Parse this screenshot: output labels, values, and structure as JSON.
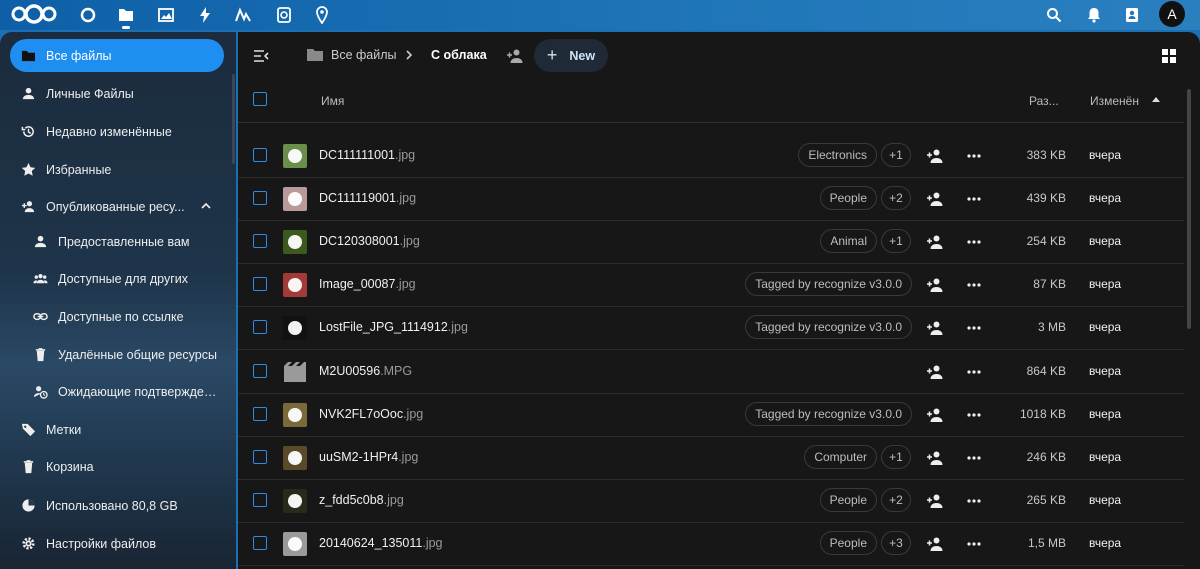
{
  "header": {
    "apps": [
      "dashboard-icon",
      "files-icon",
      "photos-icon",
      "activity-icon",
      "analytics-icon",
      "memories-icon",
      "maps-icon"
    ],
    "right_icons": [
      "search-icon",
      "notifications-icon",
      "contacts-icon"
    ],
    "avatar_initial": "A"
  },
  "sidebar": {
    "items": [
      {
        "label": "Все файлы",
        "icon": "folder-icon"
      },
      {
        "label": "Личные Файлы",
        "icon": "person-icon"
      },
      {
        "label": "Недавно изменённые",
        "icon": "history-icon"
      },
      {
        "label": "Избранные",
        "icon": "star-icon"
      },
      {
        "label": "Опубликованные ресу...",
        "icon": "share-person-icon"
      },
      {
        "label": "Предоставленные вам",
        "icon": "person-icon"
      },
      {
        "label": "Доступные для других",
        "icon": "group-icon"
      },
      {
        "label": "Доступные по ссылке",
        "icon": "link-icon"
      },
      {
        "label": "Удалённые общие ресурсы",
        "icon": "trash-icon"
      },
      {
        "label": "Ожидающие подтвержден...",
        "icon": "pending-icon"
      },
      {
        "label": "Метки",
        "icon": "tag-icon"
      },
      {
        "label": "Корзина",
        "icon": "trash-icon"
      },
      {
        "label": "Использовано 80,8 GB",
        "icon": "pie-icon"
      },
      {
        "label": "Настройки файлов",
        "icon": "gear-icon"
      }
    ]
  },
  "toolbar": {
    "breadcrumb_root": "Все файлы",
    "breadcrumb_current": "С облака",
    "new_label": "New"
  },
  "table": {
    "col_name": "Имя",
    "col_size": "Раз...",
    "col_modified": "Изменён",
    "rows": [
      {
        "base": "DC111111001",
        "ext": ".jpg",
        "tag": "Electronics",
        "more": "+1",
        "size": "383 KB",
        "date": "вчера",
        "thumb": "#6a8f4a"
      },
      {
        "base": "DC111119001",
        "ext": ".jpg",
        "tag": "People",
        "more": "+2",
        "size": "439 KB",
        "date": "вчера",
        "thumb": "#b89a9a"
      },
      {
        "base": "DC120308001",
        "ext": ".jpg",
        "tag": "Animal",
        "more": "+1",
        "size": "254 KB",
        "date": "вчера",
        "thumb": "#3d5a1e"
      },
      {
        "base": "Image_00087",
        "ext": ".jpg",
        "tag": "Tagged by recognize v3.0.0",
        "more": "",
        "size": "87 KB",
        "date": "вчера",
        "thumb": "#a33a3a"
      },
      {
        "base": "LostFile_JPG_1114912",
        "ext": ".jpg",
        "tag": "Tagged by recognize v3.0.0",
        "more": "",
        "size": "3 MB",
        "date": "вчера",
        "thumb": "#111111"
      },
      {
        "base": "M2U00596",
        "ext": ".MPG",
        "tag": "",
        "more": "",
        "size": "864 KB",
        "date": "вчера",
        "thumb": "video"
      },
      {
        "base": "NVK2FL7oOoc",
        "ext": ".jpg",
        "tag": "Tagged by recognize v3.0.0",
        "more": "",
        "size": "1018 KB",
        "date": "вчера",
        "thumb": "#7a6a3a"
      },
      {
        "base": "uuSM2-1HPr4",
        "ext": ".jpg",
        "tag": "Computer",
        "more": "+1",
        "size": "246 KB",
        "date": "вчера",
        "thumb": "#5a4a2a"
      },
      {
        "base": "z_fdd5c0b8",
        "ext": ".jpg",
        "tag": "People",
        "more": "+2",
        "size": "265 KB",
        "date": "вчера",
        "thumb": "#2a2a1a"
      },
      {
        "base": "20140624_135011",
        "ext": ".jpg",
        "tag": "People",
        "more": "+3",
        "size": "1,5 MB",
        "date": "вчера",
        "thumb": "#9a9a9a"
      }
    ]
  }
}
